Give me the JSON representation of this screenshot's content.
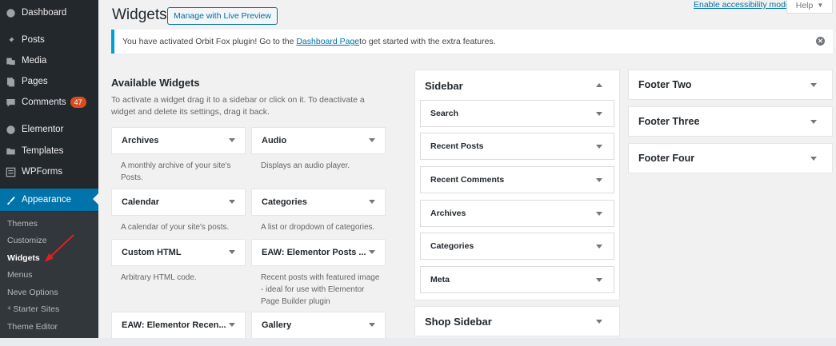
{
  "admin_menu": {
    "items": [
      {
        "label": "Dashboard",
        "icon": "dashboard-icon"
      },
      {
        "label": "Posts",
        "icon": "pin-icon"
      },
      {
        "label": "Media",
        "icon": "media-icon"
      },
      {
        "label": "Pages",
        "icon": "pages-icon"
      },
      {
        "label": "Comments",
        "icon": "comment-icon",
        "badge": "47"
      },
      {
        "label": "Elementor",
        "icon": "elementor-icon"
      },
      {
        "label": "Templates",
        "icon": "folder-icon"
      },
      {
        "label": "WPForms",
        "icon": "form-icon"
      },
      {
        "label": "Appearance",
        "icon": "brush-icon"
      }
    ],
    "submenu": [
      {
        "label": "Themes"
      },
      {
        "label": "Customize"
      },
      {
        "label": "Widgets"
      },
      {
        "label": "Menus"
      },
      {
        "label": "Neve Options"
      },
      {
        "label": "⁴ Starter Sites"
      },
      {
        "label": "Theme Editor"
      }
    ],
    "accent": "#0073aa",
    "badge_color": "#d54e21"
  },
  "header": {
    "title": "Widgets",
    "preview_button": "Manage with Live Preview",
    "accessibility_link": "Enable accessibility mode",
    "help_tab": "Help"
  },
  "notice": {
    "text_before": "You have activated Orbit Fox plugin! Go to the ",
    "link": "Dashboard Page",
    "text_after": " to get started with the extra features.",
    "border_color": "#00a0d2"
  },
  "available": {
    "title": "Available Widgets",
    "description": "To activate a widget drag it to a sidebar or click on it. To deactivate a widget and delete its settings, drag it back.",
    "widgets": [
      {
        "name": "Archives",
        "desc": "A monthly archive of your site's Posts."
      },
      {
        "name": "Audio",
        "desc": "Displays an audio player."
      },
      {
        "name": "Calendar",
        "desc": "A calendar of your site's posts."
      },
      {
        "name": "Categories",
        "desc": "A list or dropdown of categories."
      },
      {
        "name": "Custom HTML",
        "desc": "Arbitrary HTML code."
      },
      {
        "name": "EAW: Elementor Posts ...",
        "desc": "Recent posts with featured image - ideal for use with Elementor Page Builder plugin"
      },
      {
        "name": "EAW: Elementor Recen...",
        "desc": ""
      },
      {
        "name": "Gallery",
        "desc": ""
      }
    ]
  },
  "sidebar_area": {
    "title": "Sidebar",
    "widgets": [
      "Search",
      "Recent Posts",
      "Recent Comments",
      "Archives",
      "Categories",
      "Meta"
    ]
  },
  "shop_sidebar": {
    "title": "Shop Sidebar"
  },
  "footers": [
    {
      "title": "Footer Two"
    },
    {
      "title": "Footer Three"
    },
    {
      "title": "Footer Four"
    }
  ]
}
